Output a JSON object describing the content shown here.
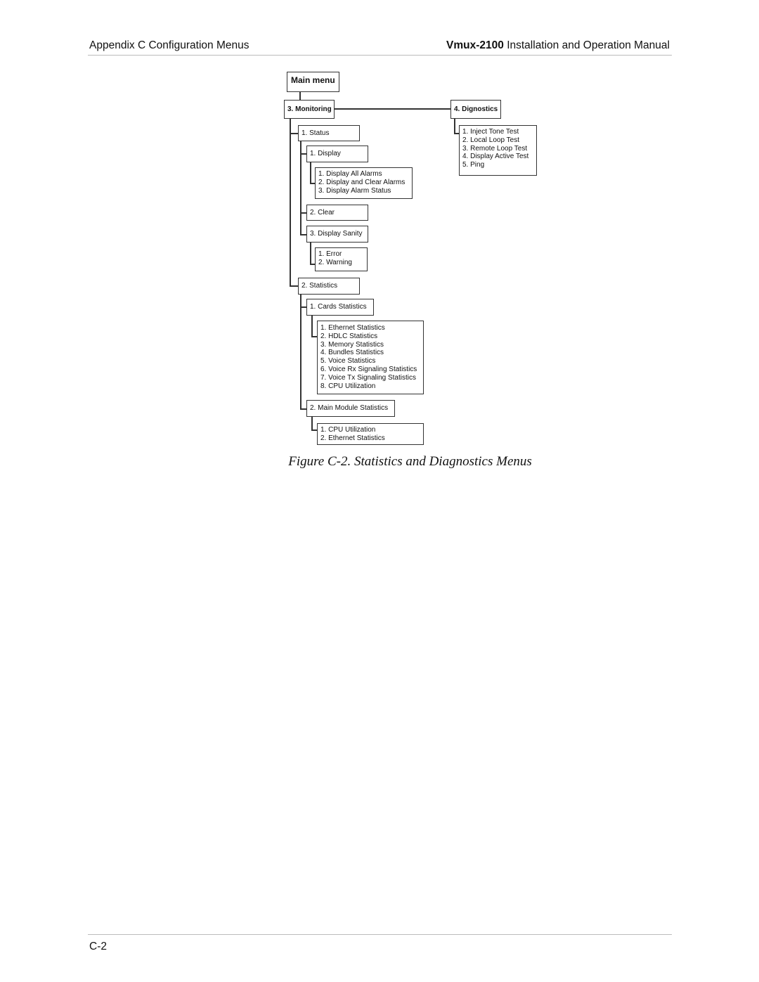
{
  "header": {
    "left": "Appendix C  Configuration Menus",
    "right_bold": "Vmux-2100",
    "right_rest": " Installation and Operation Manual"
  },
  "diagram": {
    "main_menu": "Main menu",
    "monitoring": "3. Monitoring",
    "diagnostics": "4. Dignostics",
    "diagnostics_items": [
      "1. Inject Tone Test",
      "2. Local Loop Test",
      "3. Remote Loop Test",
      "4. Display Active Test",
      "5. Ping"
    ],
    "status": "1. Status",
    "display": "1. Display",
    "display_items": [
      "1. Display All Alarms",
      "2. Display and Clear Alarms",
      "3. Display Alarm Status"
    ],
    "clear": "2. Clear",
    "display_sanity": "3. Display Sanity",
    "sanity_items": [
      "1. Error",
      "2. Warning"
    ],
    "statistics": "2. Statistics",
    "cards_statistics": "1. Cards Statistics",
    "cards_items": [
      "1. Ethernet Statistics",
      "2. HDLC Statistics",
      "3. Memory Statistics",
      "4. Bundles Statistics",
      "5. Voice Statistics",
      "6. Voice Rx Signaling Statistics",
      "7. Voice Tx Signaling Statistics",
      "8. CPU Utilization"
    ],
    "main_module_statistics": "2. Main Module Statistics",
    "main_module_items": [
      "1. CPU Utilization",
      "2. Ethernet Statistics"
    ]
  },
  "caption": "Figure C-2.  Statistics and Diagnostics Menus",
  "footer": {
    "page_number": "C-2"
  }
}
